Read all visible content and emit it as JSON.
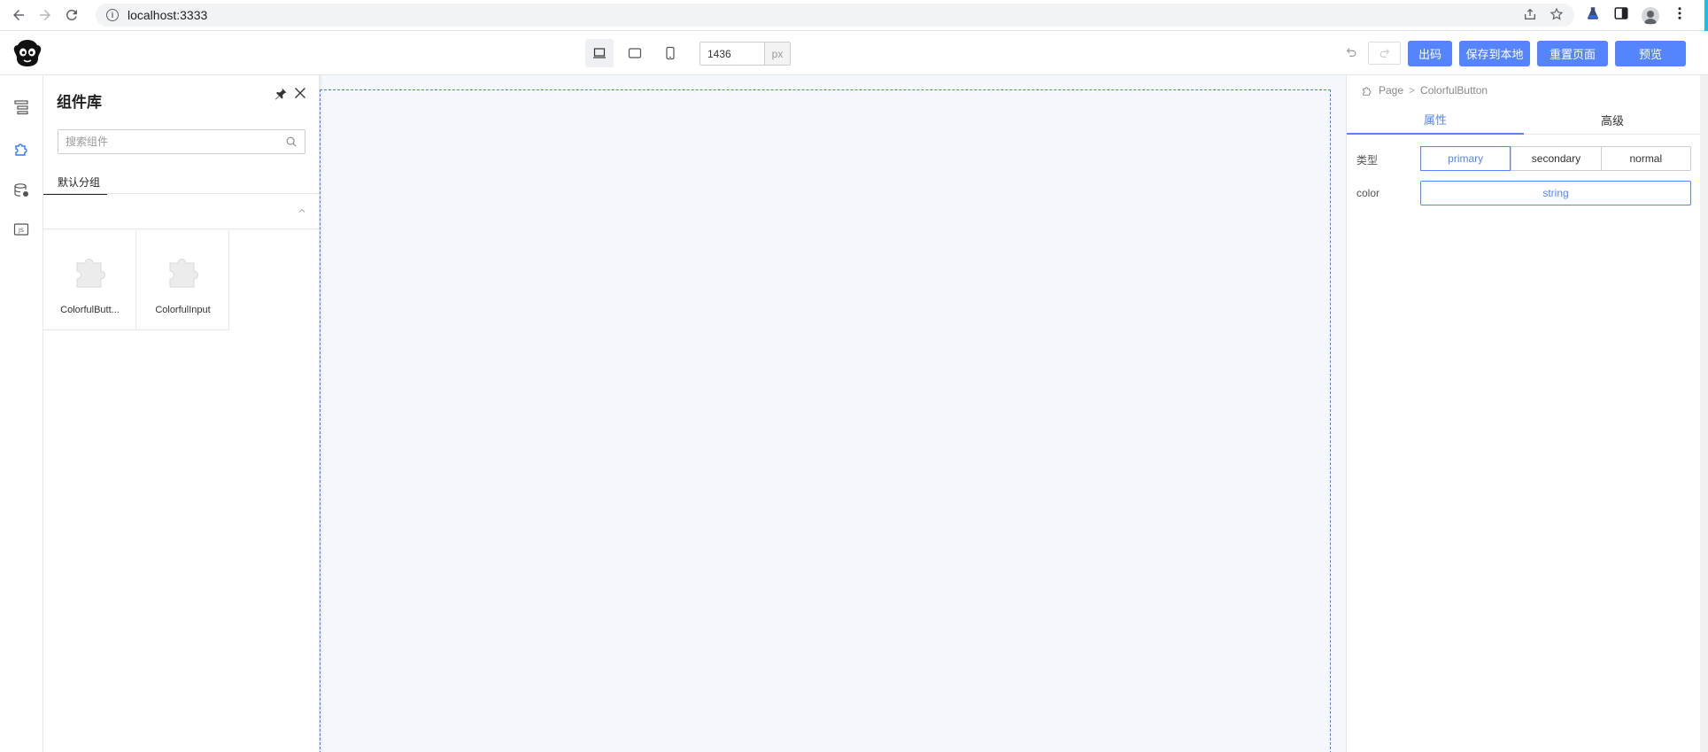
{
  "browser": {
    "url": "localhost:3333",
    "info_glyph": "i"
  },
  "toolbar": {
    "width_value": "1436",
    "width_unit": "px",
    "buttons": {
      "code": "出码",
      "save_local": "保存到本地",
      "reset_page": "重置页面",
      "preview": "预览"
    },
    "accent_color": "#5584ff"
  },
  "component_panel": {
    "title": "组件库",
    "search_placeholder": "搜索组件",
    "tabs": [
      "默认分组"
    ],
    "components": [
      {
        "label": "ColorfulButt...",
        "icon": "puzzle-icon"
      },
      {
        "label": "ColorfulInput",
        "icon": "puzzle-icon"
      }
    ]
  },
  "settings_panel": {
    "breadcrumb": [
      "Page",
      "ColorfulButton"
    ],
    "tabs": [
      "属性",
      "高级"
    ],
    "active_tab": "属性",
    "fields": {
      "type_label": "类型",
      "type_options": [
        "primary",
        "secondary",
        "normal"
      ],
      "type_selected": "primary",
      "color_label": "color",
      "color_value": "string"
    }
  },
  "canvas": {
    "background": "#f4f8fc",
    "border_color": "#4d7cf7"
  }
}
